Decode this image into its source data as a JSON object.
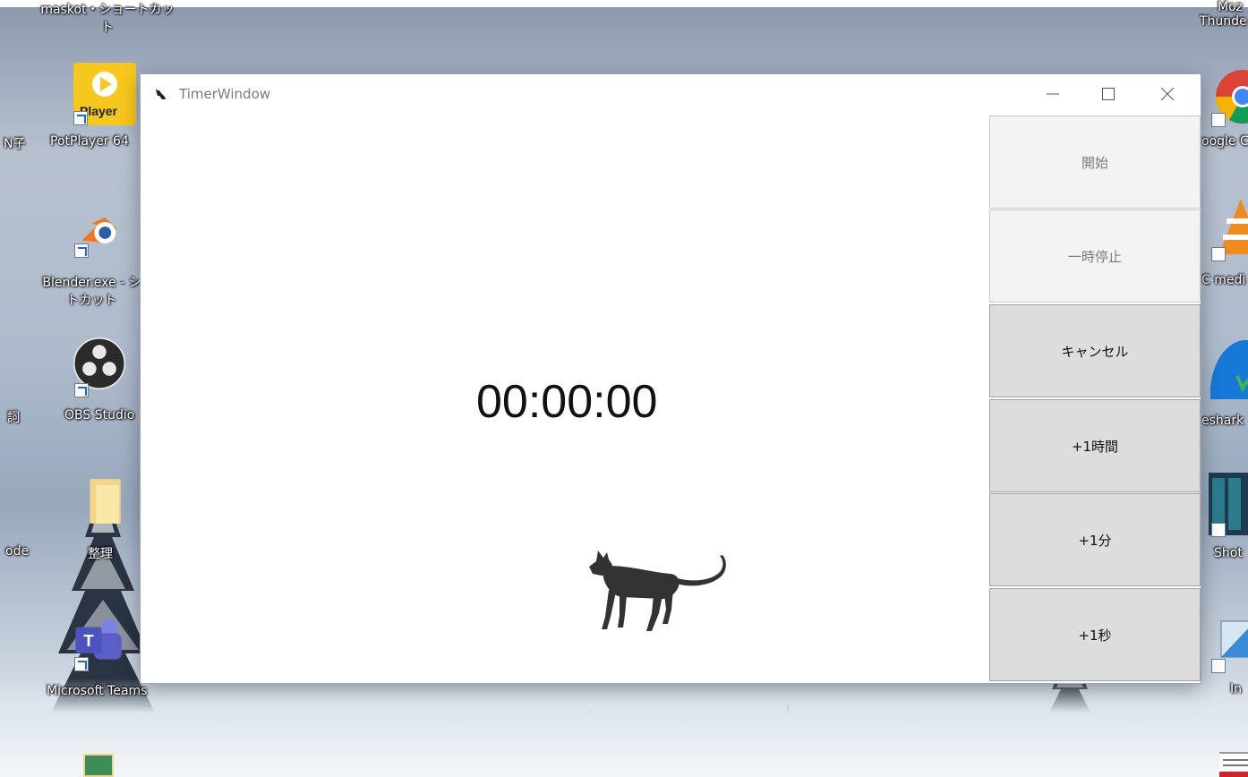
{
  "desktop": {
    "icons_left": [
      {
        "label_lines": [
          "maskot・ショートカッ",
          "ト"
        ],
        "icon": "shortcut-icon"
      },
      {
        "label_lines": [
          "PotPlayer 64"
        ],
        "icon": "potplayer-icon"
      },
      {
        "label_lines": [
          "Blender.exe - シ",
          "トカット"
        ],
        "icon": "blender-icon"
      },
      {
        "label_lines": [
          "OBS Studio"
        ],
        "icon": "obs-icon"
      },
      {
        "label_lines": [
          "整理"
        ],
        "icon": "folder-icon"
      },
      {
        "label_lines": [
          "Microsoft Teams"
        ],
        "icon": "teams-icon"
      }
    ],
    "edge_labels_left": [
      "N子",
      "詞",
      "ode"
    ],
    "icons_right": [
      {
        "label_lines": [
          "Moz",
          "Thunde"
        ],
        "icon": "thunderbird-icon"
      },
      {
        "label_lines": [
          "oogle C"
        ],
        "icon": "chrome-icon"
      },
      {
        "label_lines": [
          "C medi"
        ],
        "icon": "vlc-icon"
      },
      {
        "label_lines": [
          "eshark"
        ],
        "icon": "wireshark-icon"
      },
      {
        "label_lines": [
          "Shot"
        ],
        "icon": "shotcut-icon"
      },
      {
        "label_lines": [
          "In"
        ],
        "icon": "app-icon"
      }
    ],
    "player_badge": "Player"
  },
  "window": {
    "title": "TimerWindow",
    "timer": "00:00:00",
    "buttons": [
      {
        "label": "開始",
        "enabled": false
      },
      {
        "label": "一時停止",
        "enabled": false
      },
      {
        "label": "キャンセル",
        "enabled": true
      },
      {
        "label": "+1時間",
        "enabled": true
      },
      {
        "label": "+1分",
        "enabled": true
      },
      {
        "label": "+1秒",
        "enabled": true
      }
    ]
  },
  "colors": {
    "window_bg": "#ffffff",
    "button_disabled_bg": "#f3f3f3",
    "button_enabled_bg": "#dddddd",
    "cat": "#333333"
  }
}
